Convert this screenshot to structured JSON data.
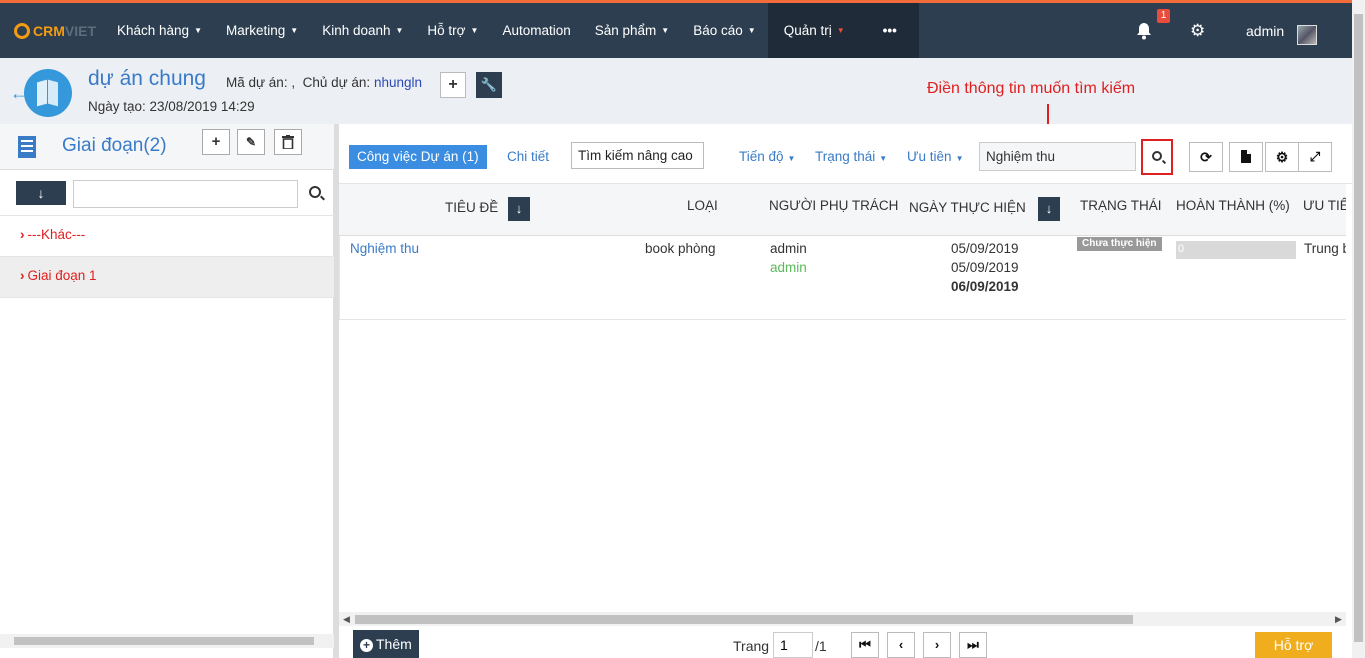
{
  "logo": {
    "part1": "CRM",
    "part2": "VIET"
  },
  "nav": {
    "items": [
      {
        "label": "Khách hàng",
        "caret": "▼"
      },
      {
        "label": "Marketing",
        "caret": "▼"
      },
      {
        "label": "Kinh doanh",
        "caret": "▼"
      },
      {
        "label": "Hỗ trợ",
        "caret": "▼"
      },
      {
        "label": "Automation",
        "caret": ""
      },
      {
        "label": "Sản phẩm",
        "caret": "▼"
      },
      {
        "label": "Báo cáo",
        "caret": "▼"
      },
      {
        "label": "Quản trị",
        "caret": "▼"
      }
    ],
    "more": "•••",
    "notification_count": "1",
    "user": "admin"
  },
  "project": {
    "name": "dự án chung",
    "code_label": "Mã dự án: ,",
    "owner_label": "Chủ dự án:",
    "owner": "nhungln",
    "created": "Ngày tạo: 23/08/2019 14:29"
  },
  "annotation": "Điền thông tin muốn tìm kiếm",
  "left_panel": {
    "title": "Giai đoạn(2)",
    "stages": [
      {
        "label": "---Khác---"
      },
      {
        "label": "Giai đoạn 1"
      }
    ]
  },
  "toolbar": {
    "tab_active": "Công việc Dự án (1)",
    "tab_detail": "Chi tiết",
    "advanced_search": "Tìm kiếm nâng cao",
    "filters": [
      "Tiến độ",
      "Trạng thái",
      "Ưu tiên"
    ],
    "search_value": "Nghiệm thu"
  },
  "grid": {
    "columns": [
      "TIÊU ĐỀ",
      "LOẠI",
      "NGƯỜI PHỤ TRÁCH",
      "NGÀY THỰC HIỆN",
      "TRẠNG THÁI",
      "HOÀN THÀNH (%)",
      "ƯU TIÊN"
    ],
    "rows": [
      {
        "title": "Nghiệm thu",
        "type": "book phòng",
        "assignee": "admin",
        "assignee2": "admin",
        "date1": "05/09/2019",
        "date2": "05/09/2019",
        "date3": "06/09/2019",
        "status": "Chưa thực hiện",
        "progress_label": "0",
        "progress": 0,
        "priority": "Trung bình"
      }
    ]
  },
  "footer": {
    "add": "Thêm",
    "page_label": "Trang",
    "page_value": "1",
    "page_total": "/1",
    "help": "Hỗ trợ"
  },
  "colors": {
    "accent": "#3a8de0",
    "nav_bg": "#2c3e50",
    "alert": "#e02020",
    "help": "#f0ad1e"
  }
}
